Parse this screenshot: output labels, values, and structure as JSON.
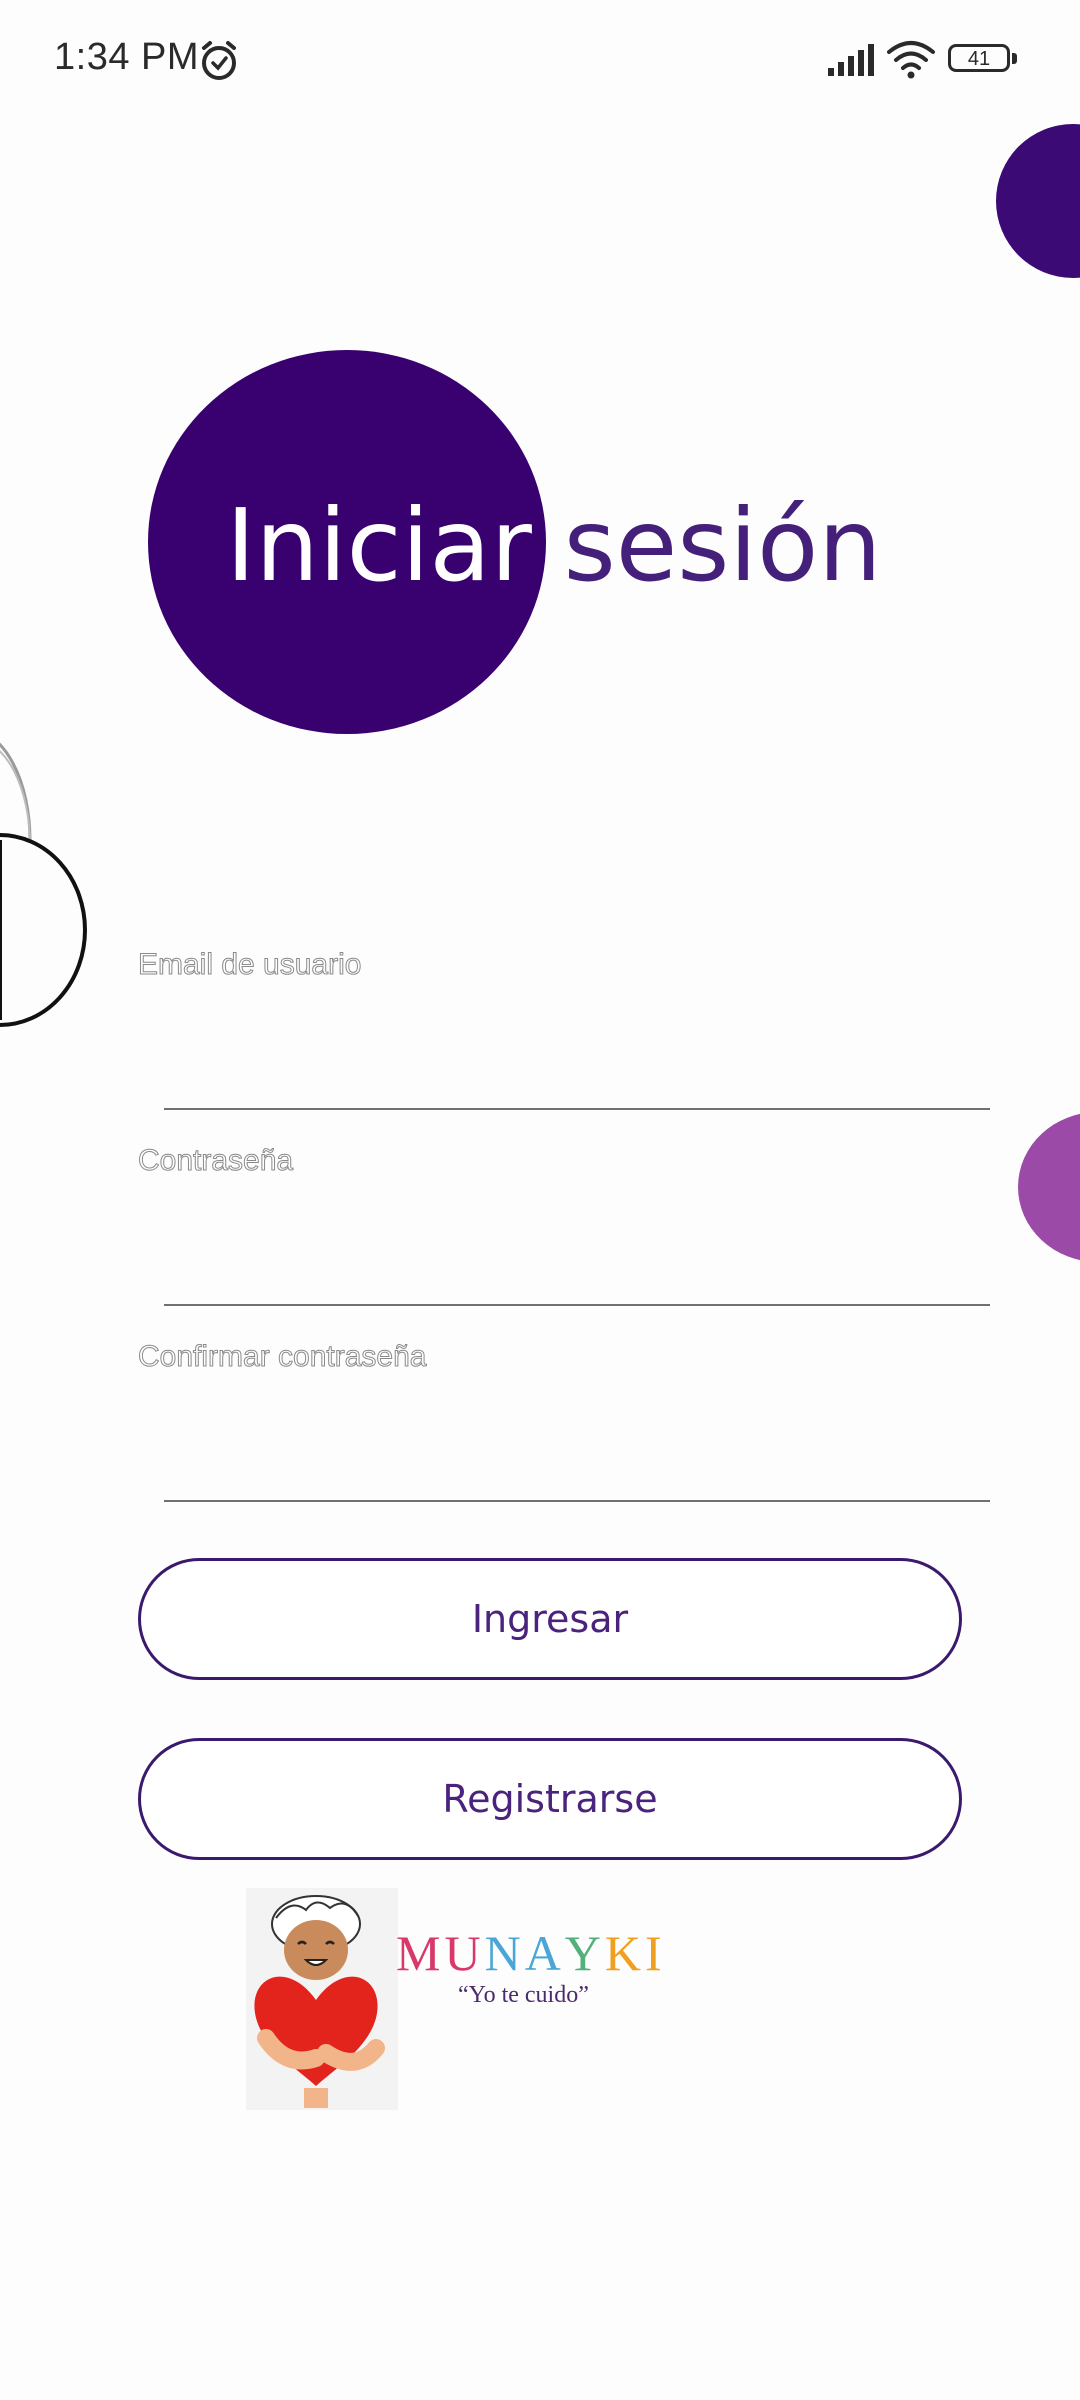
{
  "status_bar": {
    "time": "1:34 PM",
    "battery_level": "41",
    "icons": [
      "alarm-icon",
      "signal-icon",
      "wifi-icon",
      "battery-icon"
    ]
  },
  "login": {
    "title_part1": "Iniciar",
    "title_part2": "sesión",
    "email_label": "Email de usuario",
    "email_value": "",
    "password_label": "Contraseña",
    "password_value": "",
    "confirm_label": "Confirmar contraseña",
    "confirm_value": "",
    "login_button": "Ingresar",
    "register_button": "Registrarse"
  },
  "logo": {
    "brand_letters": [
      "M",
      "U",
      "N",
      "A",
      "Y",
      "K",
      "I"
    ],
    "brand_colors": [
      "#d8386a",
      "#d8386a",
      "#4aa6d6",
      "#4aa6d6",
      "#52b07a",
      "#f0a020",
      "#f0a020"
    ],
    "tagline": "“Yo te cuido”",
    "mascot_icon": "grandma-heart-icon"
  },
  "colors": {
    "primary": "#390070",
    "accent_purple": "#9c4aa8",
    "title_text": "#45207a",
    "button_border": "#3b1a6e"
  }
}
